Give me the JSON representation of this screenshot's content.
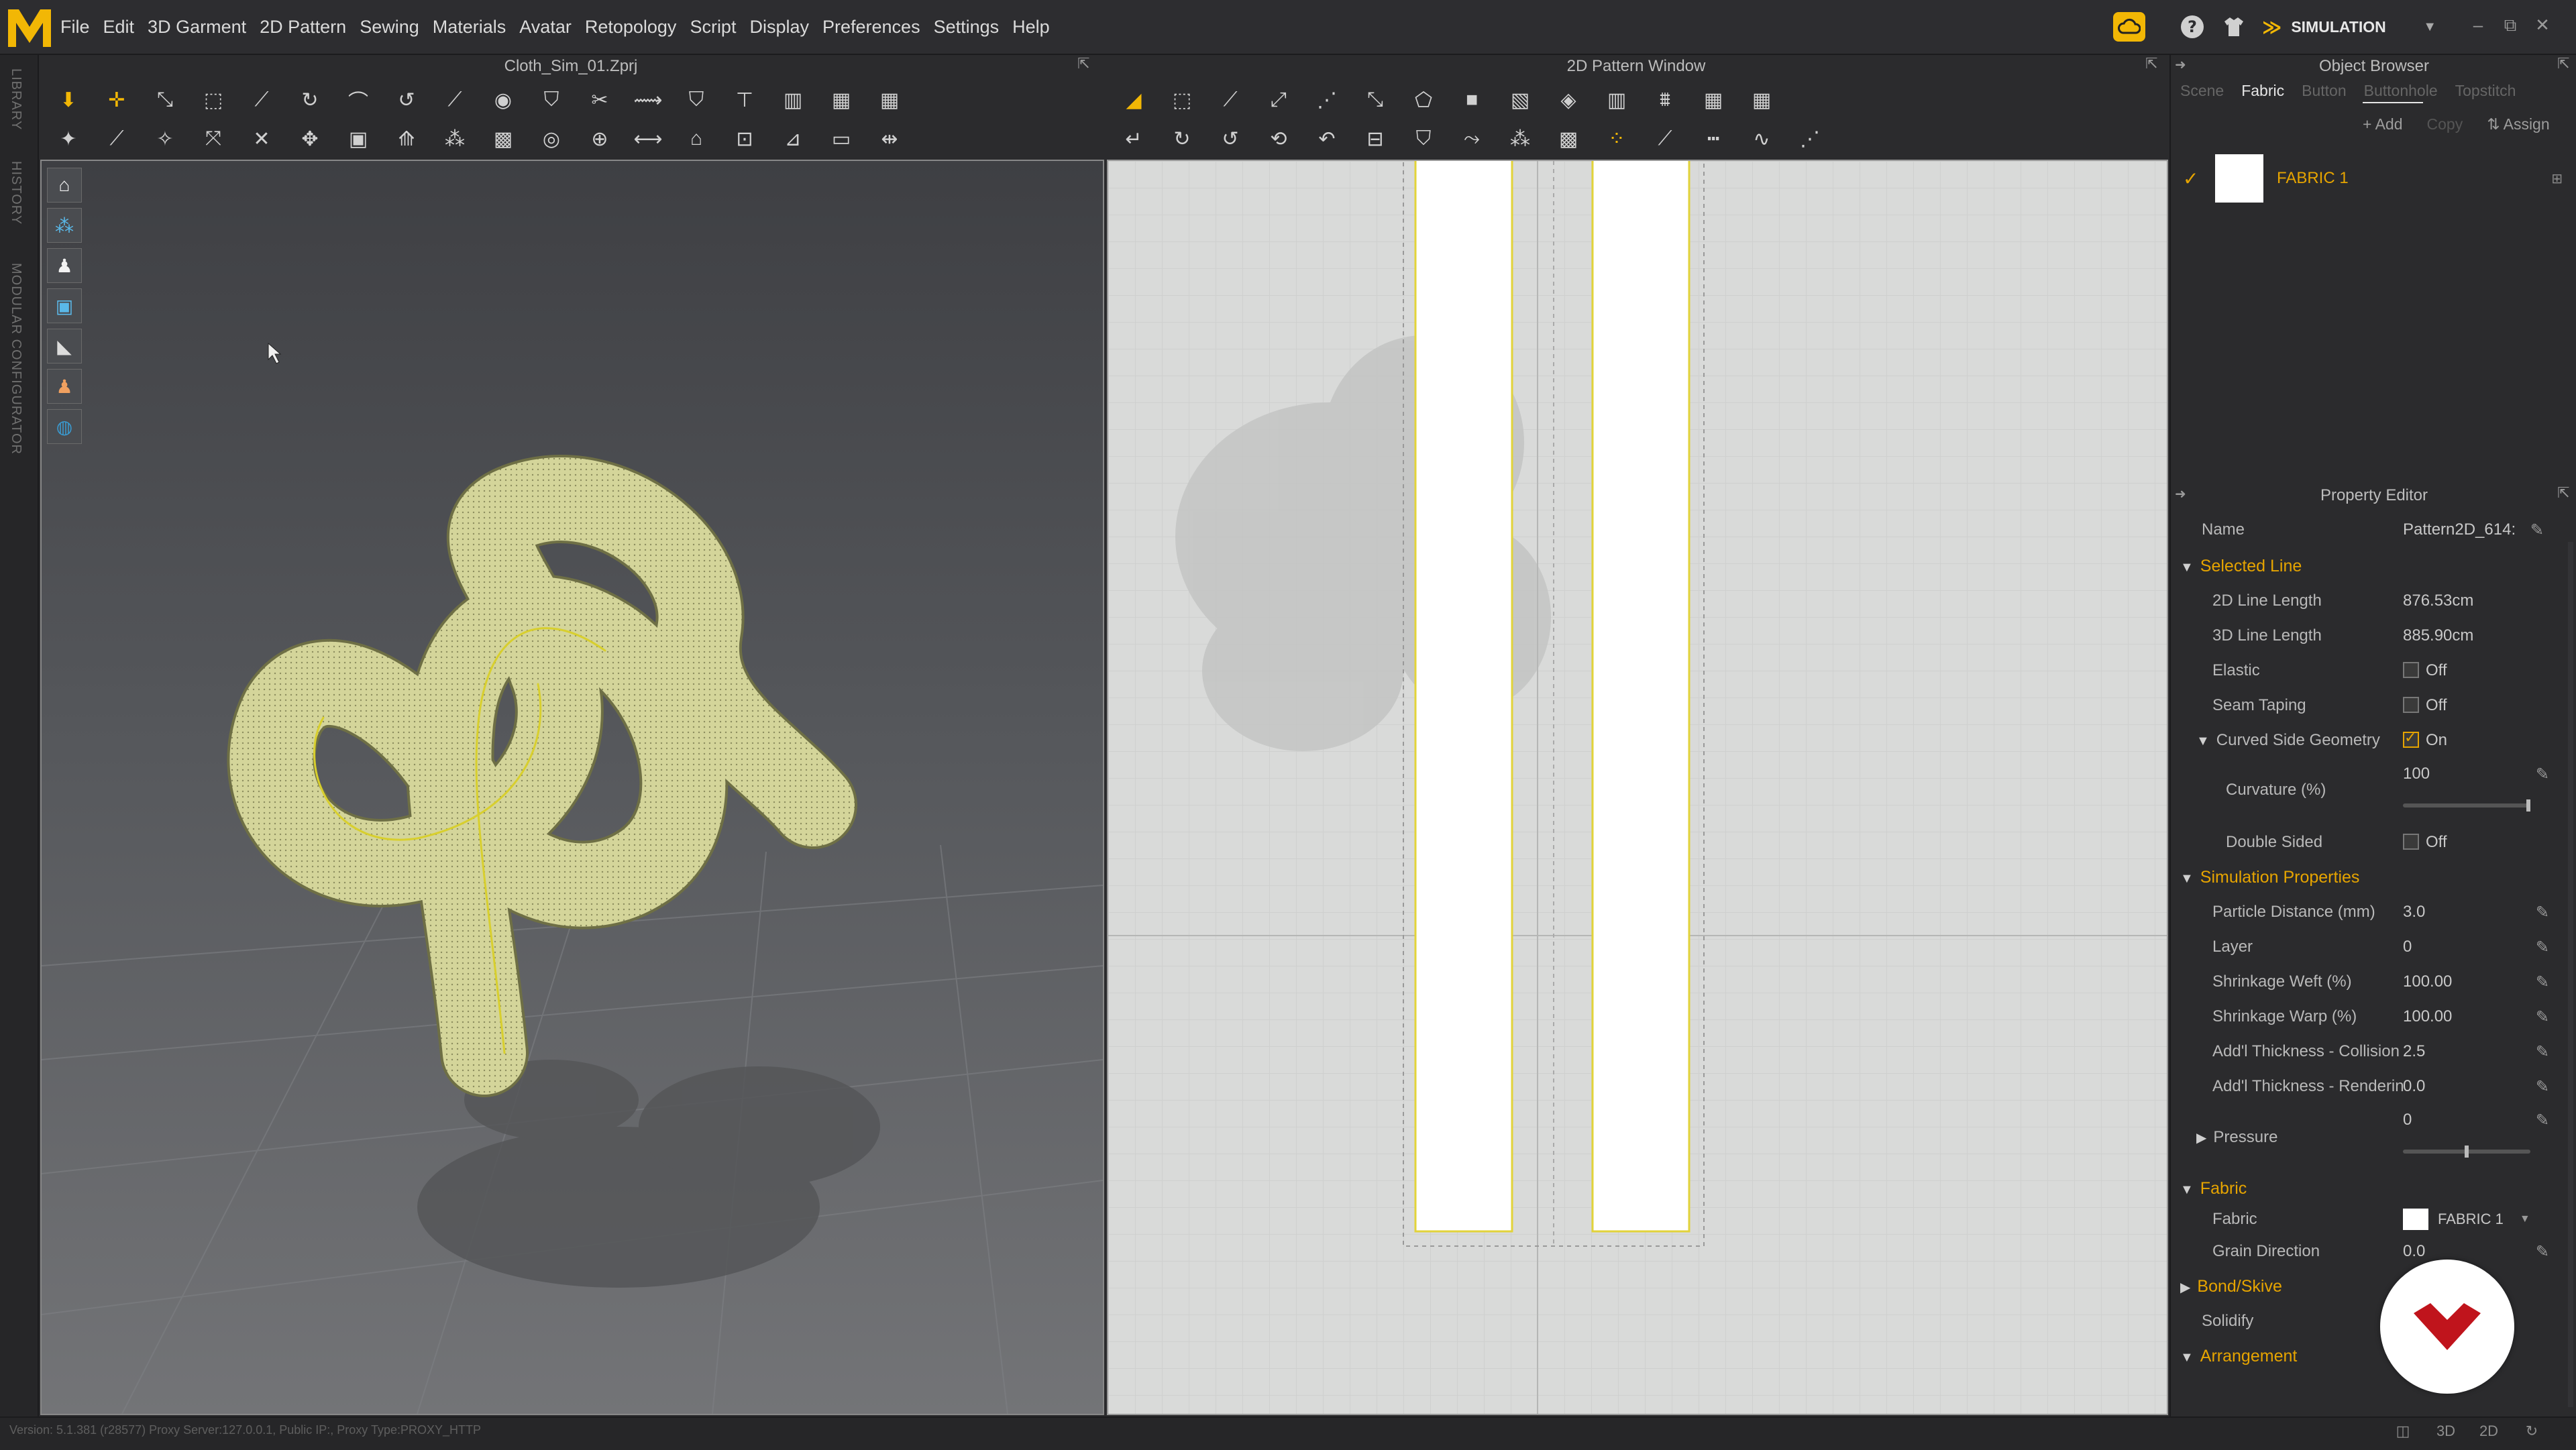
{
  "app": {
    "menus": [
      "File",
      "Edit",
      "3D Garment",
      "2D Pattern",
      "Sewing",
      "Materials",
      "Avatar",
      "Retopology",
      "Script",
      "Display",
      "Preferences",
      "Settings",
      "Help"
    ],
    "mode_label": "SIMULATION",
    "accent": "#e6a400"
  },
  "left_strip": {
    "tabs": [
      "LIBRARY",
      "HISTORY",
      "MODULAR CONFIGURATOR"
    ]
  },
  "viewport3d": {
    "title": "Cloth_Sim_01.Zprj",
    "garment_color": "#d6d79a"
  },
  "viewport2d": {
    "title": "2D Pattern Window",
    "pattern_outline": "#e2d33a"
  },
  "object_browser": {
    "title": "Object Browser",
    "tabs": [
      "Scene",
      "Fabric",
      "Button",
      "Buttonhole",
      "Topstitch"
    ],
    "active_tab": "Fabric",
    "actions": {
      "add": "Add",
      "copy": "Copy",
      "assign": "Assign"
    },
    "fabric_item": "FABRIC 1"
  },
  "property_editor": {
    "title": "Property Editor",
    "name_label": "Name",
    "name_value": "Pattern2D_614:",
    "selected_line": {
      "title": "Selected Line",
      "line2d_label": "2D Line Length",
      "line2d_value": "876.53cm",
      "line3d_label": "3D Line Length",
      "line3d_value": "885.90cm",
      "elastic_label": "Elastic",
      "elastic_value": "Off",
      "seam_label": "Seam Taping",
      "seam_value": "Off",
      "curved_label": "Curved Side Geometry",
      "curved_value": "On",
      "curvature_label": "Curvature (%)",
      "curvature_value": "100",
      "curvature_fraction": 1.0,
      "double_label": "Double Sided",
      "double_value": "Off"
    },
    "simulation": {
      "title": "Simulation Properties",
      "particle_label": "Particle Distance (mm)",
      "particle_value": "3.0",
      "layer_label": "Layer",
      "layer_value": "0",
      "weft_label": "Shrinkage Weft (%)",
      "weft_value": "100.00",
      "warp_label": "Shrinkage Warp (%)",
      "warp_value": "100.00",
      "collision_label": "Add'l Thickness - Collision",
      "collision_value": "2.5",
      "rendering_label": "Add'l Thickness - Renderin",
      "rendering_value": "0.0",
      "pressure_label": "Pressure",
      "pressure_value": "0",
      "pressure_fraction": 0.5
    },
    "fabric": {
      "title": "Fabric",
      "fabric_label": "Fabric",
      "fabric_value": "FABRIC 1",
      "grain_label": "Grain Direction",
      "grain_value": "0.0"
    },
    "bond_title": "Bond/Skive",
    "solidify_label": "Solidify",
    "arrangement_title": "Arrangement"
  },
  "status": {
    "text": "Version: 5.1.381 (r28577)   Proxy Server:127.0.0.1, Public IP:, Proxy Type:PROXY_HTTP"
  }
}
